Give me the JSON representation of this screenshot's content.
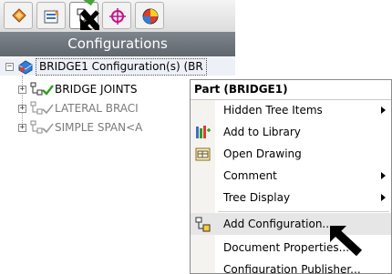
{
  "panel": {
    "tabs": [
      {
        "icon": "feature-manager-icon"
      },
      {
        "icon": "property-manager-icon"
      },
      {
        "icon": "configuration-manager-icon",
        "active": true
      },
      {
        "icon": "dimxpert-manager-icon"
      },
      {
        "icon": "display-manager-icon"
      }
    ],
    "header_title": "Configurations"
  },
  "tree": {
    "root_label": "BRIDGE1 Configuration(s)  (BR",
    "children": [
      {
        "label": "BRIDGE JOINTS",
        "active": true
      },
      {
        "label": "LATERAL BRACI",
        "active": false
      },
      {
        "label": "SIMPLE SPAN<A",
        "active": false
      }
    ]
  },
  "context_menu": {
    "title": "Part (BRIDGE1)",
    "items": [
      {
        "label": "Hidden Tree Items",
        "submenu": true,
        "icon": ""
      },
      {
        "label": "Add to Library",
        "submenu": false,
        "icon": "add-to-library-icon"
      },
      {
        "label": "Open Drawing",
        "submenu": false,
        "icon": "open-drawing-icon"
      },
      {
        "label": "Comment",
        "submenu": true,
        "icon": ""
      },
      {
        "label": "Tree Display",
        "submenu": true,
        "icon": ""
      },
      {
        "label": "Add Configuration...",
        "submenu": false,
        "icon": "add-configuration-icon",
        "highlighted": true
      },
      {
        "label": "Document Properties...",
        "submenu": false,
        "icon": ""
      },
      {
        "label": "Configuration Publisher...",
        "submenu": false,
        "icon": ""
      }
    ]
  },
  "colors": {
    "header_bg": "#6b7178",
    "check_green": "#2e9e1f",
    "menu_gutter": "#f4f3ef"
  }
}
